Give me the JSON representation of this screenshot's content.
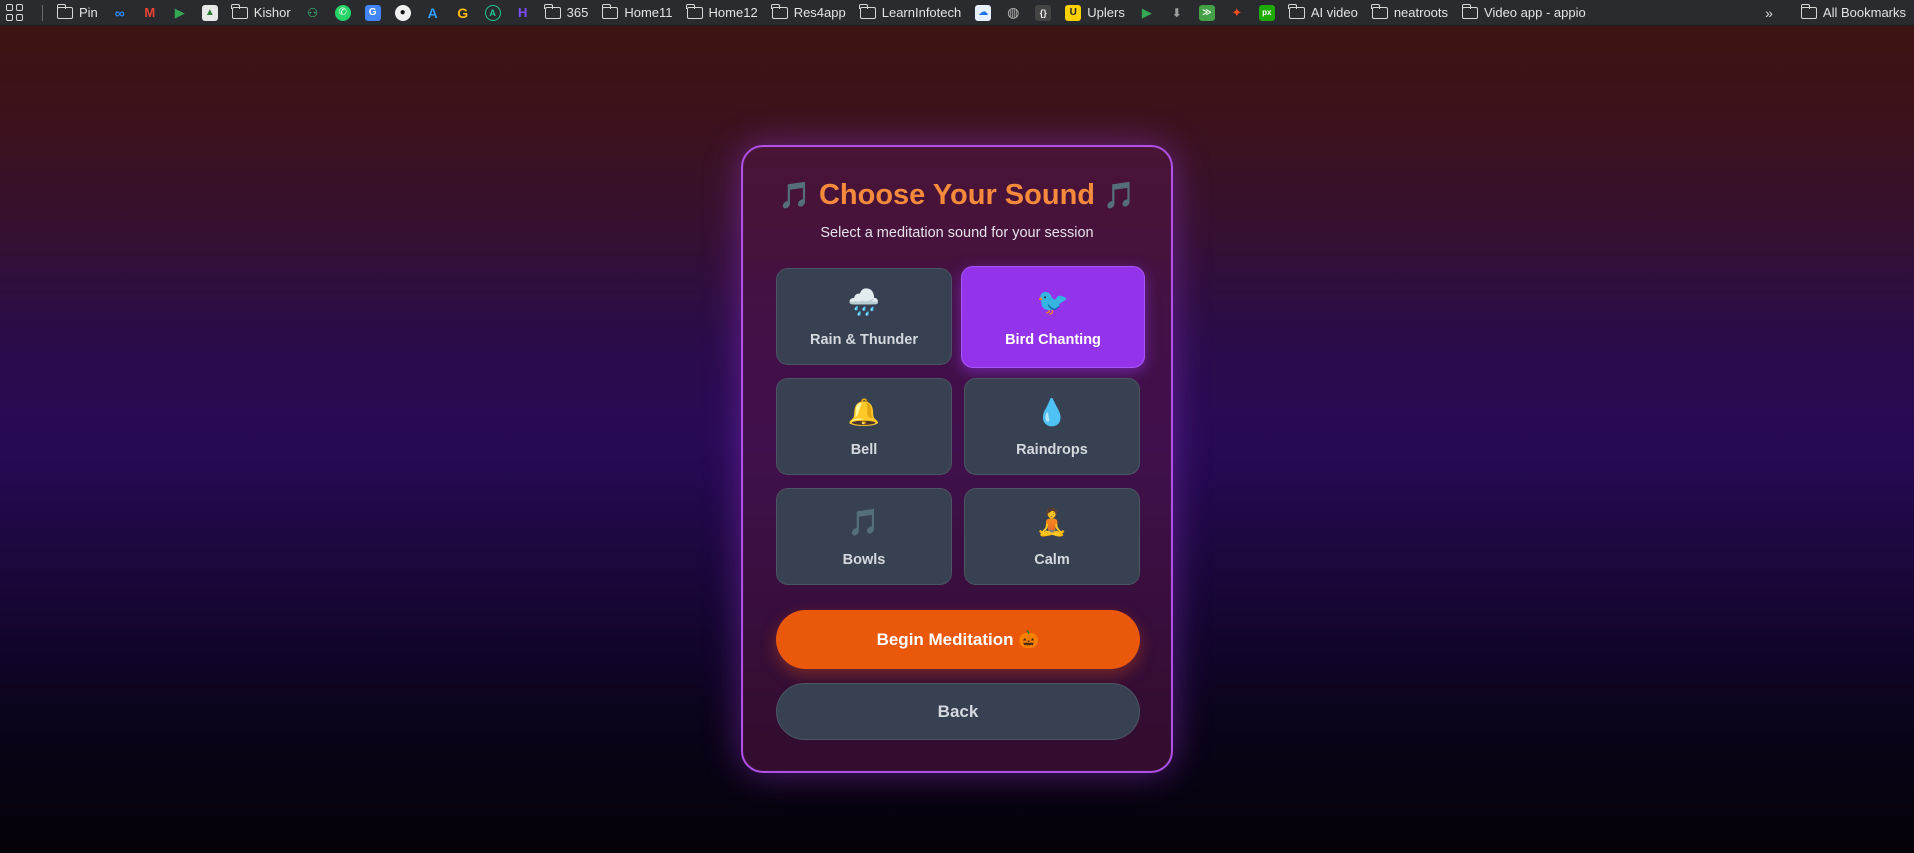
{
  "bookmarks": {
    "items": [
      {
        "type": "folder",
        "label": "Pin"
      },
      {
        "type": "icon",
        "icon": "meta-icon"
      },
      {
        "type": "icon",
        "icon": "gmail-icon"
      },
      {
        "type": "icon",
        "icon": "play-store-icon"
      },
      {
        "type": "icon",
        "icon": "image-icon"
      },
      {
        "type": "folder",
        "label": "Kishor"
      },
      {
        "type": "icon",
        "icon": "android-icon"
      },
      {
        "type": "icon",
        "icon": "whatsapp-icon"
      },
      {
        "type": "icon",
        "icon": "translate-icon"
      },
      {
        "type": "icon",
        "icon": "github-icon"
      },
      {
        "type": "icon",
        "icon": "app-store-icon"
      },
      {
        "type": "icon",
        "icon": "google-icon"
      },
      {
        "type": "icon",
        "icon": "circle-a-icon"
      },
      {
        "type": "icon",
        "icon": "purple-logo-icon"
      },
      {
        "type": "folder",
        "label": "365"
      },
      {
        "type": "folder",
        "label": "Home11"
      },
      {
        "type": "folder",
        "label": "Home12"
      },
      {
        "type": "folder",
        "label": "Res4app"
      },
      {
        "type": "folder",
        "label": "LearnInfotech"
      },
      {
        "type": "icon",
        "icon": "cloud-icon"
      },
      {
        "type": "icon",
        "icon": "globe-icon"
      },
      {
        "type": "icon",
        "icon": "braces-icon"
      },
      {
        "type": "site",
        "icon": "uplers-icon",
        "label": "Uplers"
      },
      {
        "type": "icon",
        "icon": "play-store-icon"
      },
      {
        "type": "icon",
        "icon": "pin-icon"
      },
      {
        "type": "icon",
        "icon": "chevron-green-icon"
      },
      {
        "type": "icon",
        "icon": "figma-icon"
      },
      {
        "type": "icon",
        "icon": "px-icon"
      },
      {
        "type": "folder",
        "label": "AI video"
      },
      {
        "type": "folder",
        "label": "neatroots"
      },
      {
        "type": "folder",
        "label": "Video app - appio"
      }
    ],
    "more": "»",
    "all_label": "All Bookmarks"
  },
  "card": {
    "title_note_left": "🎵",
    "title": "Choose Your Sound",
    "title_note_right": "🎵",
    "subtitle": "Select a meditation sound for your session"
  },
  "sounds": [
    {
      "emoji": "🌧️",
      "label": "Rain & Thunder",
      "selected": false
    },
    {
      "emoji": "🐦",
      "label": "Bird Chanting",
      "selected": true
    },
    {
      "emoji": "🔔",
      "label": "Bell",
      "selected": false
    },
    {
      "emoji": "💧",
      "label": "Raindrops",
      "selected": false
    },
    {
      "emoji": "🎵",
      "label": "Bowls",
      "selected": false
    },
    {
      "emoji": "🧘",
      "label": "Calm",
      "selected": false
    }
  ],
  "actions": {
    "begin_label": "Begin Meditation 🎃",
    "back_label": "Back"
  },
  "colors": {
    "accent_orange": "#ea580c",
    "title_orange": "#f58a3c",
    "selected_purple": "#9334ea",
    "card_border": "#b050e8",
    "tile_bg": "#374151"
  }
}
